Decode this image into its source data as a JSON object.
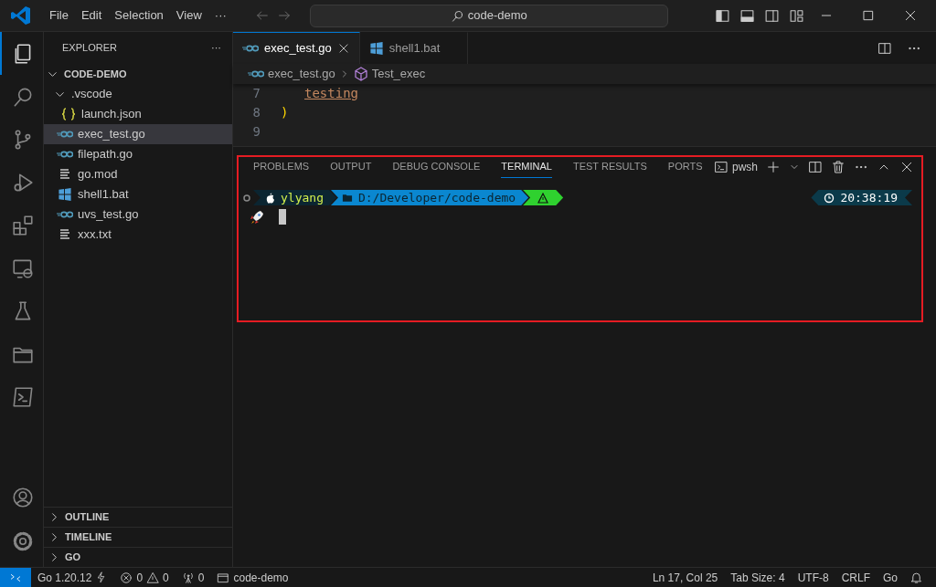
{
  "title_bar": {
    "menus": [
      "File",
      "Edit",
      "Selection",
      "View",
      "···"
    ],
    "search": "code-demo"
  },
  "activity_bar": [
    {
      "kind": "files",
      "selected": true
    },
    {
      "kind": "search",
      "selected": false
    },
    {
      "kind": "branch",
      "selected": false
    },
    {
      "kind": "debug",
      "selected": false
    },
    {
      "kind": "extensions",
      "selected": false
    },
    {
      "kind": "remote",
      "selected": false
    },
    {
      "kind": "flask",
      "selected": false
    },
    {
      "kind": "folder",
      "selected": false
    },
    {
      "kind": "terminal",
      "selected": false
    }
  ],
  "activity_bottom": [
    {
      "kind": "account"
    },
    {
      "kind": "gear"
    }
  ],
  "sidebar": {
    "title": "EXPLORER",
    "more": "···",
    "tree": [
      {
        "label": "CODE-DEMO",
        "kind": "root",
        "expanded": true,
        "selected": false,
        "children": [
          {
            "label": ".vscode",
            "kind": "folder",
            "expanded": true,
            "selected": false,
            "children": [
              {
                "label": "launch.json",
                "kind": "json",
                "selected": false
              }
            ]
          },
          {
            "label": "exec_test.go",
            "kind": "go",
            "selected": true
          },
          {
            "label": "filepath.go",
            "kind": "go",
            "selected": false
          },
          {
            "label": "go.mod",
            "kind": "lines",
            "selected": false
          },
          {
            "label": "shell1.bat",
            "kind": "bat",
            "selected": false
          },
          {
            "label": "uvs_test.go",
            "kind": "go",
            "selected": false
          },
          {
            "label": "xxx.txt",
            "kind": "lines",
            "selected": false
          }
        ]
      }
    ],
    "sections": [
      {
        "label": "OUTLINE",
        "expanded": false
      },
      {
        "label": "TIMELINE",
        "expanded": false
      },
      {
        "label": "GO",
        "expanded": false
      }
    ]
  },
  "editor": {
    "tabs": [
      {
        "label": "exec_test.go",
        "kind": "go",
        "selected": true
      },
      {
        "label": "shell1.bat",
        "kind": "bat",
        "selected": false
      }
    ],
    "breadcrumb": [
      {
        "label": "exec_test.go",
        "kind": "go"
      },
      {
        "label": "Test_exec",
        "kind": "symbol"
      }
    ],
    "lines": [
      {
        "number": "7",
        "code": "testing",
        "kind": "link"
      },
      {
        "number": "8",
        "code": ")",
        "kind": "paren"
      },
      {
        "number": "9"
      }
    ]
  },
  "panel": {
    "tabs": [
      {
        "label": "PROBLEMS",
        "selected": false
      },
      {
        "label": "OUTPUT",
        "selected": false
      },
      {
        "label": "DEBUG CONSOLE",
        "selected": false
      },
      {
        "label": "TERMINAL",
        "selected": true
      },
      {
        "label": "TEST RESULTS",
        "selected": false
      },
      {
        "label": "PORTS",
        "selected": false
      }
    ],
    "shell": "pwsh",
    "prompt": {
      "user": "ylyang",
      "path": "D:/Developer/code-demo",
      "time": "20:38:19"
    }
  },
  "status_bar": {
    "left": [
      {
        "kind": "go",
        "text": "Go 1.20.12"
      },
      {
        "kind": "problems",
        "errors": "0",
        "warnings": "0"
      },
      {
        "kind": "ports",
        "text": "0"
      },
      {
        "kind": "folder",
        "text": "code-demo"
      }
    ],
    "right": [
      "Ln 17, Col 25",
      "Tab Size: 4",
      "UTF-8",
      "CRLF",
      "Go"
    ]
  }
}
